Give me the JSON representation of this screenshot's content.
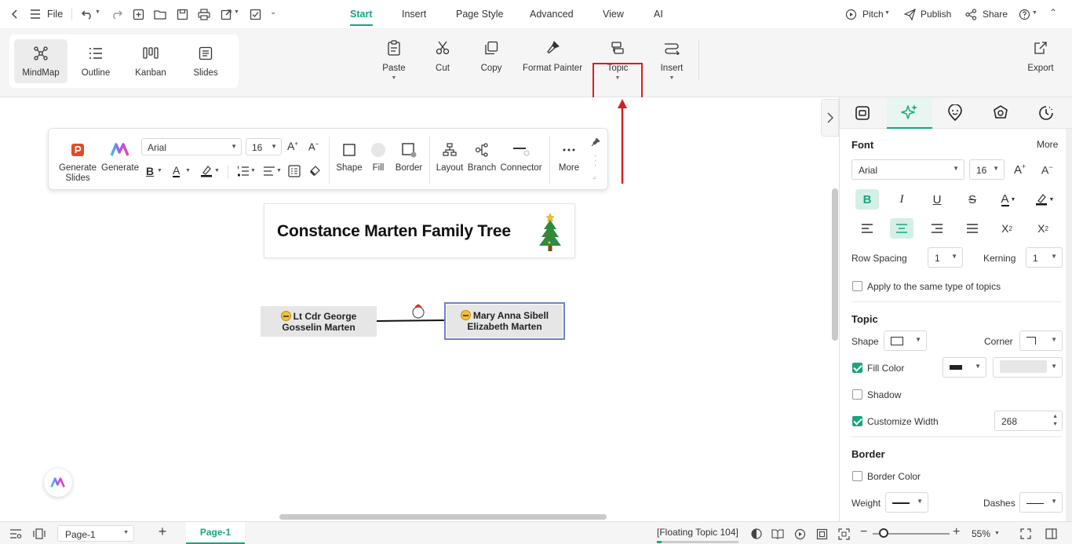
{
  "titlebar": {
    "file_label": "File",
    "menu_tabs": [
      "Start",
      "Insert",
      "Page Style",
      "Advanced",
      "View",
      "AI"
    ],
    "active_tab": "Start",
    "pitch_label": "Pitch",
    "publish_label": "Publish",
    "share_label": "Share"
  },
  "ribbon": {
    "views": [
      "MindMap",
      "Outline",
      "Kanban",
      "Slides"
    ],
    "selected_view": "MindMap",
    "buttons": {
      "paste": "Paste",
      "cut": "Cut",
      "copy": "Copy",
      "format_painter": "Format Painter",
      "topic": "Topic",
      "insert": "Insert",
      "export": "Export"
    }
  },
  "floating_toolbar": {
    "generate_slides": "Generate Slides",
    "generate": "Generate",
    "font": "Arial",
    "font_size": "16",
    "shape": "Shape",
    "fill": "Fill",
    "border": "Border",
    "layout": "Layout",
    "branch": "Branch",
    "connector": "Connector",
    "more": "More"
  },
  "mindmap": {
    "title": "Constance Marten Family Tree",
    "node1_line1": "Lt Cdr George",
    "node1_line2": "Gosselin Marten",
    "node2_line1": "Mary Anna Sibell",
    "node2_line2": "Elizabeth Marten"
  },
  "right_panel": {
    "font_heading": "Font",
    "more_label": "More",
    "font_family": "Arial",
    "font_size": "16",
    "row_spacing_label": "Row Spacing",
    "row_spacing_value": "1",
    "kerning_label": "Kerning",
    "kerning_value": "1",
    "apply_same_label": "Apply to the same type of topics",
    "topic_heading": "Topic",
    "shape_label": "Shape",
    "corner_label": "Corner",
    "fill_color_label": "Fill Color",
    "shadow_label": "Shadow",
    "customize_width_label": "Customize Width",
    "width_value": "268",
    "border_heading": "Border",
    "border_color_label": "Border Color",
    "weight_label": "Weight",
    "dashes_label": "Dashes"
  },
  "statusbar": {
    "page_select": "Page-1",
    "page_tab": "Page-1",
    "floating_topic": "[Floating Topic 104]",
    "zoom": "55%"
  },
  "colors": {
    "accent": "#1aa57f",
    "highlight_red": "#d51f27",
    "node_fill": "#e6e6e6",
    "node_selected_border": "#6e82c6"
  }
}
